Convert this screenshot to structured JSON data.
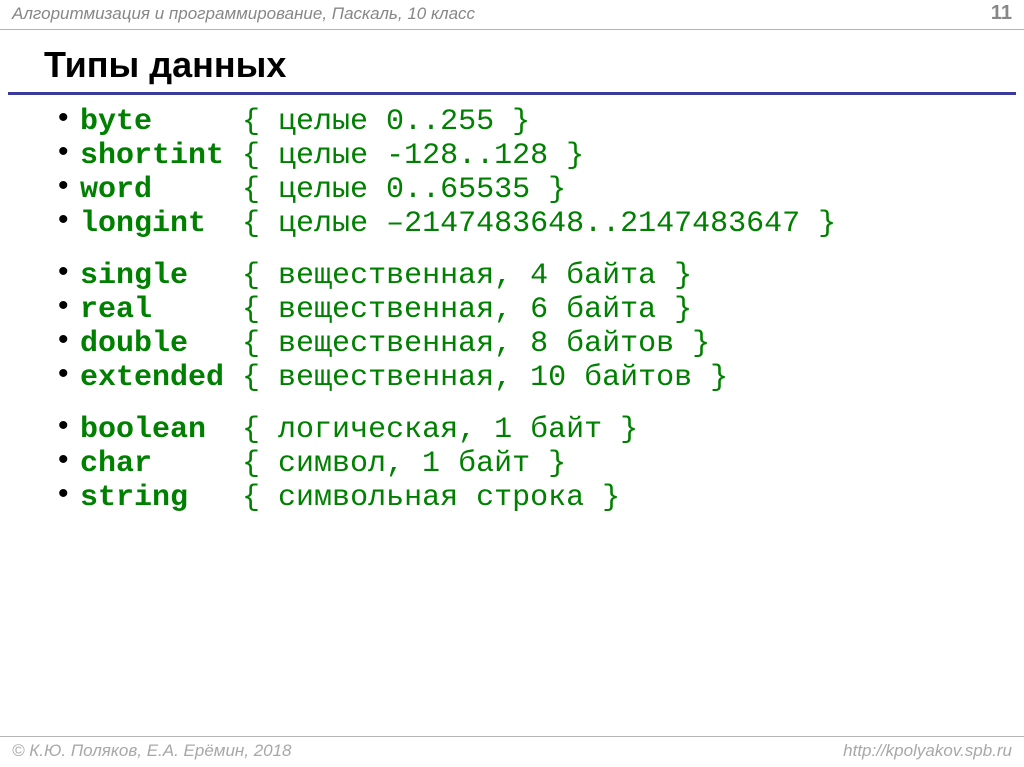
{
  "header": {
    "title": "Алгоритмизация и программирование, Паскаль, 10 класс",
    "page": "11"
  },
  "slide_title": "Типы данных",
  "groups": [
    {
      "rows": [
        {
          "kw": "byte",
          "pad": "     ",
          "desc": "{ целые 0..255 }"
        },
        {
          "kw": "shortint",
          "pad": " ",
          "desc": "{ целые -128..128 }"
        },
        {
          "kw": "word",
          "pad": "     ",
          "desc": "{ целые 0..65535 }"
        },
        {
          "kw": "longint",
          "pad": "  ",
          "desc": "{ целые –2147483648..2147483647 }"
        }
      ]
    },
    {
      "rows": [
        {
          "kw": "single",
          "pad": "   ",
          "desc": "{ вещественная, 4 байта }"
        },
        {
          "kw": "real",
          "pad": "     ",
          "desc": "{ вещественная, 6 байта }"
        },
        {
          "kw": "double",
          "pad": "   ",
          "desc": "{ вещественная, 8 байтов }"
        },
        {
          "kw": "extended",
          "pad": " ",
          "desc": "{ вещественная, 10 байтов }"
        }
      ]
    },
    {
      "rows": [
        {
          "kw": "boolean",
          "pad": "  ",
          "desc": "{ логическая, 1 байт }"
        },
        {
          "kw": "char",
          "pad": "     ",
          "desc": "{ символ, 1 байт }"
        },
        {
          "kw": "string",
          "pad": "   ",
          "desc": "{ символьная строка }"
        }
      ]
    }
  ],
  "footer": {
    "copyright": "© К.Ю. Поляков, Е.А. Ерёмин, 2018",
    "url": "http://kpolyakov.spb.ru"
  }
}
